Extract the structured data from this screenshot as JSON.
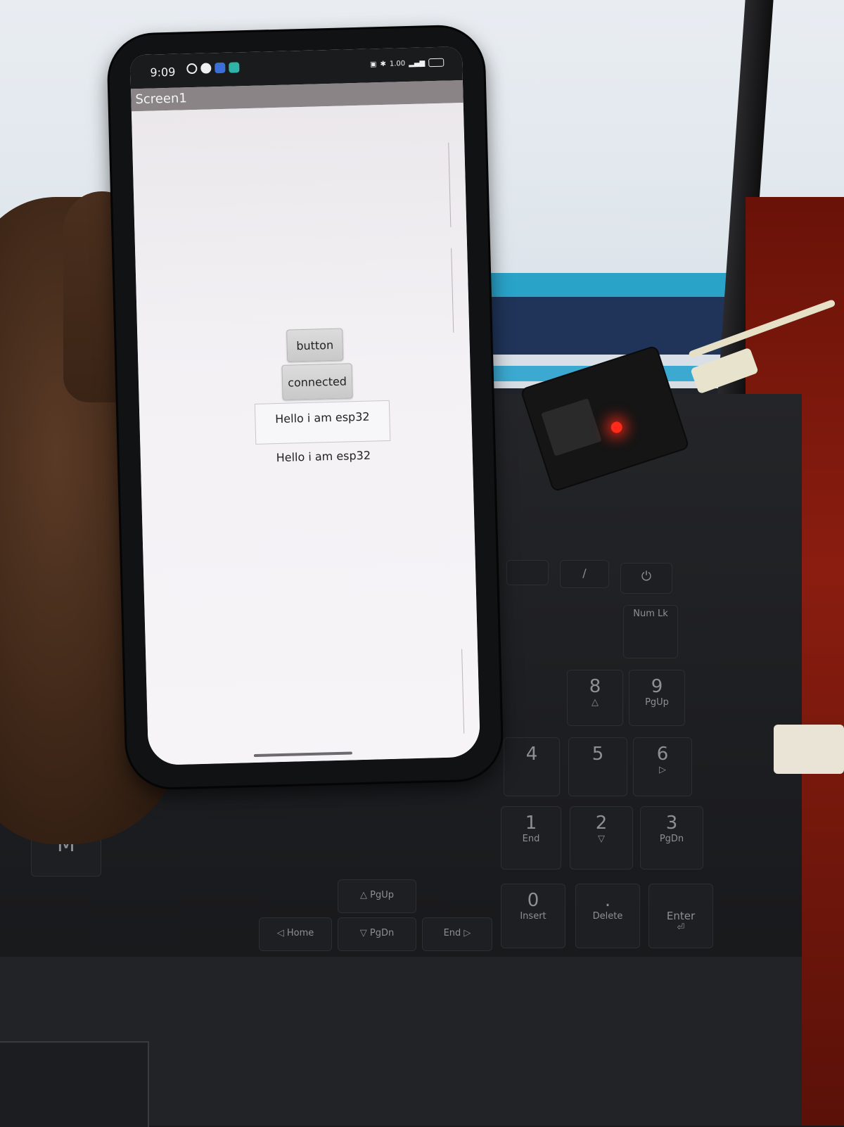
{
  "phone": {
    "status_bar": {
      "time": "9:09",
      "left_icons": [
        "whatsapp-icon",
        "app-icon-a",
        "app-icon-blue",
        "app-icon-teal"
      ],
      "right_icons": [
        "screenshot-icon",
        "bluetooth-icon",
        "data-speed",
        "signal-icon",
        "battery-icon"
      ],
      "data_speed": "1.00"
    },
    "app": {
      "title": "Screen1",
      "button_label": "button",
      "connect_label": "connected",
      "textbox_value": "Hello i am esp32",
      "label_text": "Hello i am esp32"
    },
    "colors": {
      "title_bar": "#8a8487",
      "screen_bg": "#f3f0f3",
      "button_bg": "#d3d3d3"
    }
  },
  "keyboard": {
    "keys": [
      {
        "main": "",
        "sub": ""
      },
      {
        "main": "/",
        "sub": ""
      },
      {
        "main": "⏻",
        "sub": ""
      },
      {
        "main": "",
        "sub": "Num Lk"
      },
      {
        "main": "8",
        "sub": "△"
      },
      {
        "main": "9",
        "sub": "PgUp"
      },
      {
        "main": "4",
        "sub": ""
      },
      {
        "main": "5",
        "sub": ""
      },
      {
        "main": "6",
        "sub": "▷"
      },
      {
        "main": "1",
        "sub": "End"
      },
      {
        "main": "2",
        "sub": "▽"
      },
      {
        "main": "3",
        "sub": "PgDn"
      },
      {
        "main": "0",
        "sub": "Insert"
      },
      {
        "main": ".",
        "sub": "Delete"
      },
      {
        "main": "Enter",
        "sub": "⏎"
      },
      {
        "main": "M",
        "sub": ""
      },
      {
        "main": "",
        "sub": "△ PgUp"
      },
      {
        "main": "",
        "sub": "◁ Home"
      },
      {
        "main": "",
        "sub": "▽ PgDn"
      },
      {
        "main": "",
        "sub": "End ▷"
      }
    ]
  }
}
